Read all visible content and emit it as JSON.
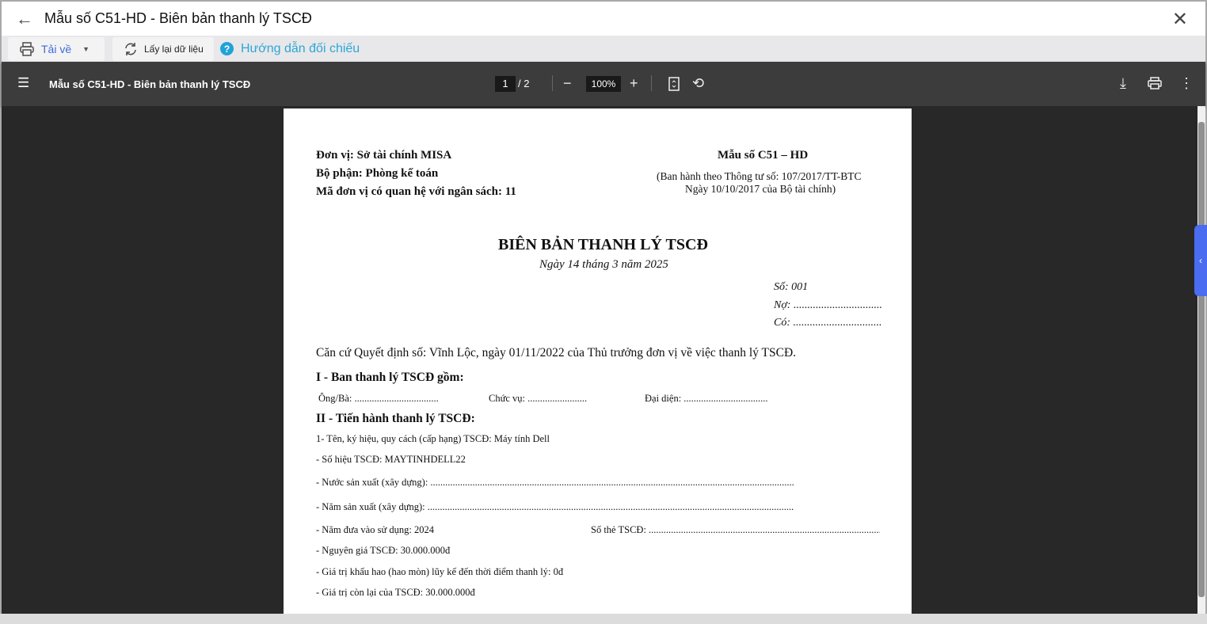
{
  "window": {
    "title": "Mẫu số C51-HD - Biên bản thanh lý TSCĐ"
  },
  "toolbar": {
    "download_label": "Tải về",
    "reload_label": "Lấy lại dữ liệu",
    "help_label": "Hướng dẫn đối chiếu",
    "help_glyph": "?"
  },
  "pdf": {
    "title": "Mẫu số C51-HD - Biên bản thanh lý TSCĐ",
    "current_page": "1",
    "total_pages": "/  2",
    "zoom": "100%"
  },
  "doc": {
    "unit": "Đơn vị: Sở tài chính MISA",
    "dept": "Bộ phận: Phòng kế toán",
    "budget_code": "Mã đơn vị có quan hệ với ngân sách: 11",
    "form_no": "Mẫu số C51 – HD",
    "issued1": "(Ban hành theo Thông tư số: 107/2017/TT-BTC",
    "issued2": "Ngày 10/10/2017 của Bộ tài chính)",
    "heading": "BIÊN BẢN THANH LÝ TSCĐ",
    "date": "Ngày 14 tháng 3 năm 2025",
    "so": "Số: 001",
    "no": "Nợ: ................................",
    "co": "Có: ................................",
    "basis": "Căn cứ Quyết định số: Vĩnh Lộc, ngày 01/11/2022 của Thủ trưởng đơn vị về việc thanh lý TSCĐ.",
    "sec1": "I - Ban thanh lý TSCĐ gồm:",
    "ongba": "Ông/Bà: ..................................",
    "chucvu": "Chức vụ: ........................",
    "daidien": "Đại diện: ..................................",
    "sec2": "II - Tiến hành thanh lý TSCĐ:",
    "l1": "1- Tên, ký hiệu, quy cách (cấp hạng) TSCĐ: Máy tính Dell",
    "l2": "- Số hiệu TSCĐ: MAYTINHDELL22",
    "l3": "- Nước sản xuất (xây dựng): ...................................................................................................................................................",
    "l4": "- Năm sản xuất (xây dựng): ....................................................................................................................................................",
    "l5": "- Năm đưa vào sử dụng: 2024",
    "l5b": "Số thẻ TSCĐ: ...............................................................................................",
    "l6": "- Nguyên giá TSCĐ: 30.000.000đ",
    "l7": "- Giá trị khấu hao (hao mòn) lũy kế đến thời điểm thanh lý: 0đ",
    "l8": "- Giá trị còn lại của TSCĐ: 30.000.000đ"
  }
}
